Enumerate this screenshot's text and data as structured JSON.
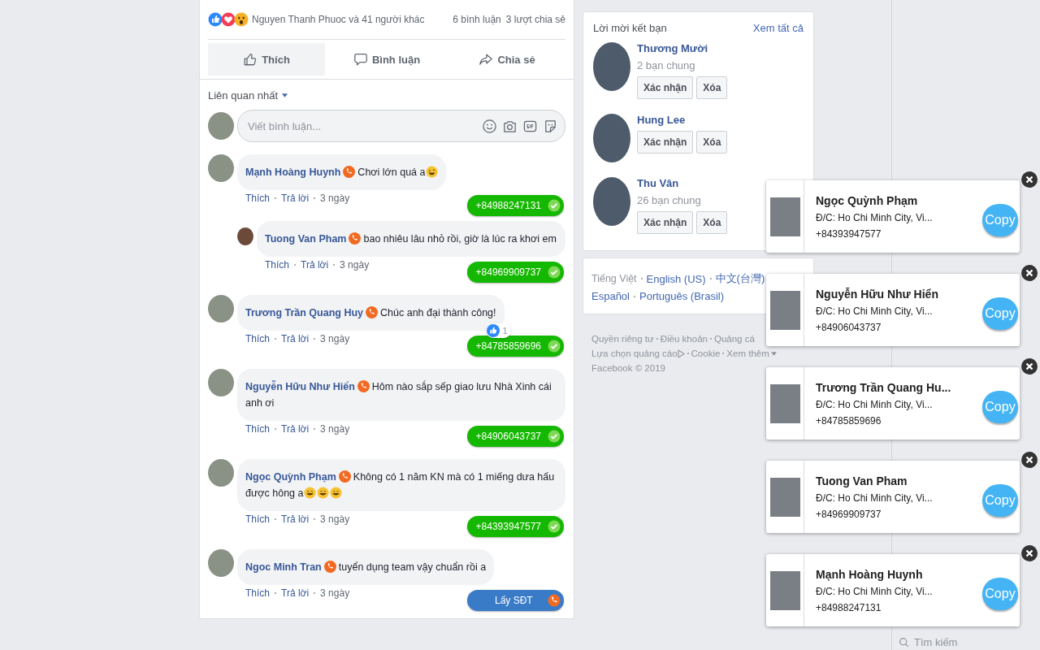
{
  "post": {
    "reactions_summary": "Nguyen Thanh Phuoc và 41 người khác",
    "reaction_icons": [
      {
        "kind": "like"
      },
      {
        "kind": "love"
      },
      {
        "kind": "wow"
      }
    ],
    "comment_count": "6 bình luận",
    "share_count": "3 lượt chia sẻ",
    "actions": [
      {
        "kind": "like",
        "label": "Thích",
        "selected": true
      },
      {
        "kind": "comment",
        "label": "Bình luận",
        "selected": false
      },
      {
        "kind": "share",
        "label": "Chia sẻ",
        "selected": false
      }
    ],
    "sort": "Liên quan nhất",
    "comment_box": {
      "placeholder": "Viết bình luận..."
    },
    "comments": [
      {
        "author": "Mạnh Hoàng Huynh",
        "text": "Chơi lớn quá a",
        "emojis": [
          {
            "kind": "rofl"
          }
        ],
        "meta": [
          "Thích",
          "Trả lời",
          "3 ngày"
        ],
        "phone": {
          "kind": "number",
          "label": "+84988247131"
        },
        "children": [
          {
            "author": "Tuong Van Pham",
            "text": "bao nhiêu lâu nhỏ rồi, giờ là lúc ra khơi em",
            "meta": [
              "Thích",
              "Trả lời",
              "3 ngày"
            ],
            "phone": {
              "kind": "number",
              "label": "+84969909737"
            }
          }
        ]
      },
      {
        "author": "Trương Trần Quang Huy",
        "text": "Chúc anh đại thành công!",
        "likes": "1",
        "meta": [
          "Thích",
          "Trả lời",
          "3 ngày"
        ],
        "phone": {
          "kind": "number",
          "label": "+84785859696"
        }
      },
      {
        "author": "Nguyễn Hữu Như Hiển",
        "text": "Hôm nào sắp sếp giao lưu Nhà Xinh cái anh ơi",
        "meta": [
          "Thích",
          "Trả lời",
          "3 ngày"
        ],
        "phone": {
          "kind": "number",
          "label": "+84906043737"
        }
      },
      {
        "author": "Ngọc Quỳnh Phạm",
        "text": "Không có 1 năm KN mà có 1 miếng dưa hấu được hông a",
        "emojis": [
          {
            "kind": "grin"
          },
          {
            "kind": "grin"
          },
          {
            "kind": "grin"
          }
        ],
        "meta": [
          "Thích",
          "Trả lời",
          "3 ngày"
        ],
        "phone": {
          "kind": "number",
          "label": "+84393947577"
        }
      },
      {
        "author": "Ngoc Minh Tran",
        "text": "tuyển dụng team vậy chuẩn rồi a",
        "meta": [
          "Thích",
          "Trả lời",
          "3 ngày"
        ],
        "phone": {
          "kind": "get",
          "label": "Lấy SĐT"
        }
      }
    ]
  },
  "friend_requests": {
    "title": "Lời mời kết bạn",
    "see_all": "Xem tất cả",
    "items": [
      {
        "name": "Thương Mười",
        "mutual": "2 bạn chung",
        "confirm": "Xác nhận",
        "delete": "Xóa"
      },
      {
        "name": "Hung Lee",
        "confirm": "Xác nhận",
        "delete": "Xóa"
      },
      {
        "name": "Thu Vân",
        "mutual": "26 bạn chung",
        "confirm": "Xác nhận",
        "delete": "Xóa"
      }
    ]
  },
  "languages": {
    "current": "Tiếng Việt",
    "others": [
      "English (US)",
      "中文(台灣)",
      "Español",
      "Português (Brasil)"
    ]
  },
  "footer": {
    "links": [
      "Quyền riêng tư",
      "Điều khoản",
      "Quảng cá"
    ],
    "links_2": [
      "Lựa chọn quảng cáo",
      "Cookie",
      "Xem thêm"
    ],
    "copyright": "Facebook © 2019"
  },
  "chat_search": {
    "placeholder": "Tìm kiếm"
  },
  "popups": [
    {
      "name": "Ngọc Quỳnh Phạm",
      "address": "Đ/C: Ho Chi Minh City, Vi...",
      "phone": "+84393947577",
      "button": "Copy"
    },
    {
      "name": "Nguyễn Hữu Như Hiển",
      "address": "Đ/C: Ho Chi Minh City, Vi...",
      "phone": "+84906043737",
      "button": "Copy"
    },
    {
      "name": "Trương Trần Quang Hu...",
      "address": "Đ/C: Ho Chi Minh City, Vi...",
      "phone": "+84785859696",
      "button": "Copy"
    },
    {
      "name": "Tuong Van Pham",
      "address": "Đ/C: Ho Chi Minh City, Vi...",
      "phone": "+84969909737",
      "button": "Copy"
    },
    {
      "name": "Mạnh Hoàng Huynh",
      "address": "Đ/C: Ho Chi Minh City, Vi...",
      "phone": "+84988247131",
      "button": "Copy"
    }
  ]
}
